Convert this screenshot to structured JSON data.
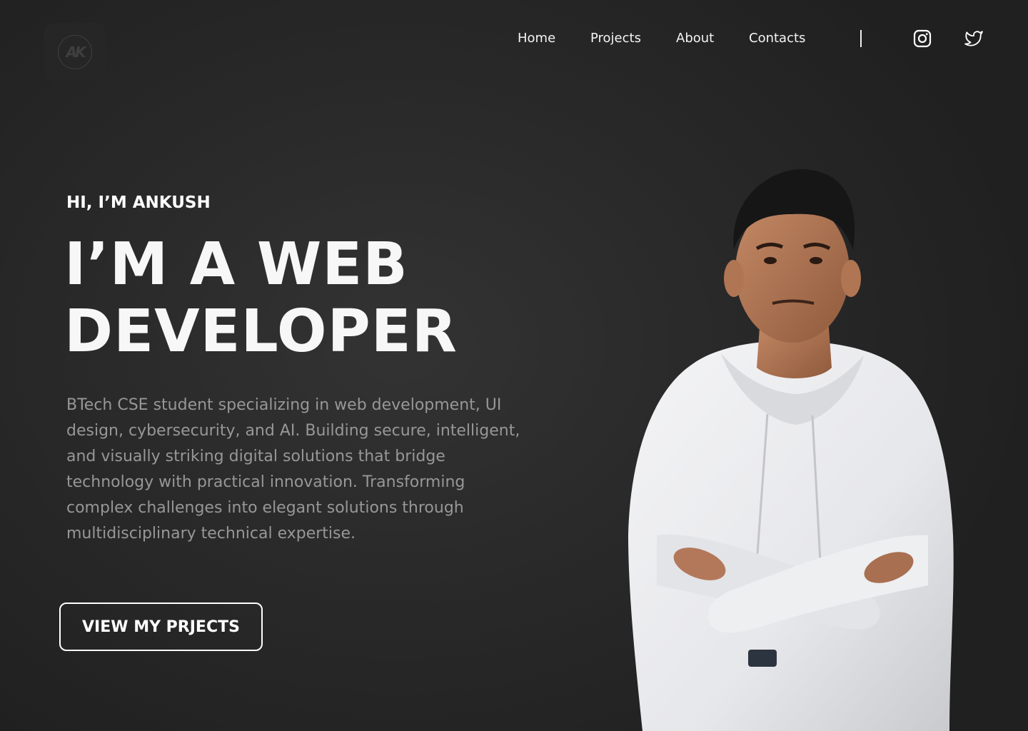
{
  "header": {
    "logo_text": "AK",
    "nav": [
      {
        "label": "Home"
      },
      {
        "label": "Projects"
      },
      {
        "label": "About"
      },
      {
        "label": "Contacts"
      }
    ],
    "social": [
      {
        "icon": "instagram-icon"
      },
      {
        "icon": "twitter-icon"
      }
    ]
  },
  "hero": {
    "greeting": "HI, I’M ANKUSH",
    "headline_line1": "I’M A WEB",
    "headline_line2": "DEVELOPER",
    "bio": "BTech CSE student specializing in web development, UI design, cybersecurity, and AI. Building secure, intelligent, and visually striking digital solutions that bridge technology with practical innovation. Transforming complex challenges into elegant solutions through multidisciplinary technical expertise.",
    "cta_label": "VIEW MY PRJECTS"
  },
  "colors": {
    "background": "#222222",
    "text_primary": "#ffffff",
    "text_muted": "#979797"
  }
}
